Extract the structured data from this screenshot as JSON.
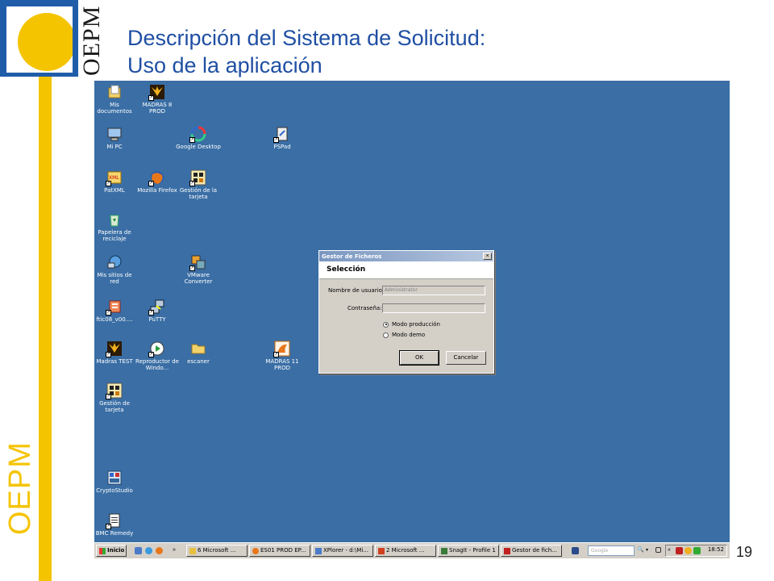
{
  "slide": {
    "logo_text": "OEPM",
    "side_text": "OEPM",
    "title_line1": "Descripción del Sistema de Solicitud:",
    "title_line2": "Uso de la aplicación",
    "page_number": "19"
  },
  "desktop": {
    "icons": [
      {
        "label": "Mis documentos",
        "icon": "my-documents-icon"
      },
      {
        "label": "MADRAS 8 PROD",
        "icon": "madras-icon"
      },
      {
        "label": "Mi PC",
        "icon": "my-computer-icon"
      },
      {
        "label": "Google Desktop",
        "icon": "google-desktop-icon"
      },
      {
        "label": "PSPad",
        "icon": "pspad-icon"
      },
      {
        "label": "PatXML",
        "icon": "patxml-icon"
      },
      {
        "label": "Mozilla Firefox",
        "icon": "firefox-icon"
      },
      {
        "label": "Gestión de la tarjeta",
        "icon": "card-management-icon"
      },
      {
        "label": "Papelera de reciclaje",
        "icon": "recycle-bin-icon"
      },
      {
        "label": "Mis sitios de red",
        "icon": "network-places-icon"
      },
      {
        "label": "VMware Converter",
        "icon": "vmware-icon"
      },
      {
        "label": "ftic08_v00....",
        "icon": "installer-icon"
      },
      {
        "label": "PuTTY",
        "icon": "putty-icon"
      },
      {
        "label": "Madras TEST",
        "icon": "madras-test-icon"
      },
      {
        "label": "Reproductor de Windo...",
        "icon": "media-player-icon"
      },
      {
        "label": "escaner",
        "icon": "folder-icon"
      },
      {
        "label": "MADRAS 11 PROD",
        "icon": "madras-11-icon"
      },
      {
        "label": "Gestión de tarjeta",
        "icon": "card-management-icon"
      },
      {
        "label": "CryptoStudio",
        "icon": "cryptostudio-icon"
      },
      {
        "label": "BMC Remedy",
        "icon": "bmc-remedy-icon"
      }
    ]
  },
  "dialog": {
    "title": "Gestor de Ficheros",
    "close": "×",
    "header": "Selección",
    "username_label": "Nombre de usuario:",
    "username_value": "Administrator",
    "password_label": "Contraseña:",
    "password_value": "",
    "mode_production": "Modo producción",
    "mode_demo": "Modo demo",
    "selected_mode": "Modo producción",
    "ok": "OK",
    "cancel": "Cancelar"
  },
  "taskbar": {
    "start": "Inicio",
    "items": [
      "6 Microsoft ...",
      "ES01 PROD EP...",
      "XPlorer - d:\\Mi...",
      "2 Microsoft ...",
      "SnagIt - Profile 1",
      "Gestor de fich..."
    ],
    "search_placeholder": "Google",
    "clock": "18:52"
  },
  "colors": {
    "desktop": "#3a6ea5",
    "title": "#1f4fa3",
    "brand_yellow": "#f5c400",
    "brand_blue": "#1f5da8"
  }
}
